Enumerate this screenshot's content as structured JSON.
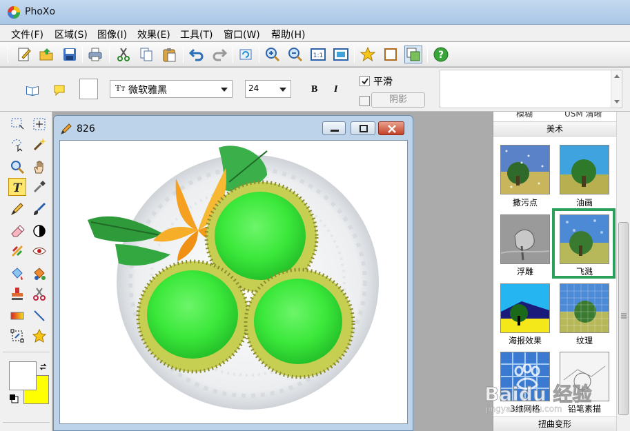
{
  "window": {
    "title": "PhoXo"
  },
  "menu": [
    "文件(F)",
    "区域(S)",
    "图像(I)",
    "效果(E)",
    "工具(T)",
    "窗口(W)",
    "帮助(H)"
  ],
  "props": {
    "font_name": "微软雅黑",
    "font_size": "24",
    "bold_label": "B",
    "italic_label": "I",
    "smooth_label": "平滑",
    "smooth_checked": true,
    "shadow_label": "阴影"
  },
  "document": {
    "title": "826"
  },
  "effects_panel": {
    "partial_top_labels": [
      "模糊",
      "USM 清晰"
    ],
    "section_art": "美术",
    "items": [
      "撒污点",
      "油画",
      "浮雕",
      "飞溅",
      "海报效果",
      "纹理",
      "3维网格",
      "铅笔素描"
    ],
    "selected": "飞溅",
    "section_next": "扭曲变形"
  },
  "watermark": {
    "text": "Baidu 经验",
    "sub": "jingyan.baidu.com"
  },
  "colors": {
    "foreground": "#ffffff",
    "background": "#ffff00",
    "selection": "#2aa05a",
    "titlebar": "#b7cfea"
  }
}
